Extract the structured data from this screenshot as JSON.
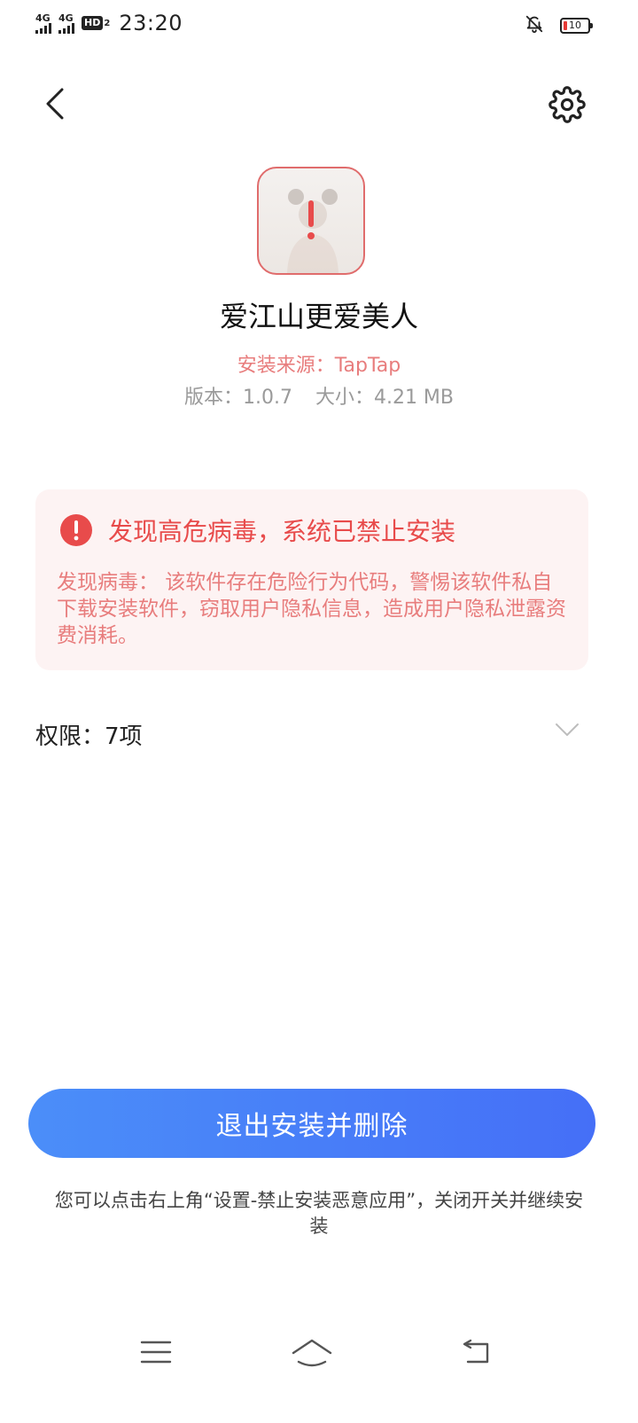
{
  "status_bar": {
    "signal1_label": "4G",
    "signal2_label": "4G",
    "hd_label": "HD",
    "hd_sub": "2",
    "time": "23:20",
    "battery_percent": "10"
  },
  "icons": {
    "back": "back-arrow-icon",
    "settings": "gear-icon",
    "warning": "exclamation-icon",
    "chevron": "chevron-down-icon",
    "nav_menu": "menu-icon",
    "nav_home": "home-icon",
    "nav_back": "return-icon",
    "notifications_off": "bell-off-icon"
  },
  "app": {
    "name": "爱江山更爱美人",
    "source": "安装来源：TapTap",
    "version": "版本：1.0.7",
    "size": "大小：4.21 MB"
  },
  "alert": {
    "title": "发现高危病毒，系统已禁止安装",
    "body": "发现病毒： 该软件存在危险行为代码，警惕该软件私自下载安装软件，窃取用户隐私信息，造成用户隐私泄露资费消耗。"
  },
  "permissions": {
    "label": "权限：7项"
  },
  "actions": {
    "primary": "退出安装并删除",
    "hint": "您可以点击右上角“设置-禁止安装恶意应用”，关闭开关并继续安装"
  },
  "colors": {
    "danger": "#e84b4b",
    "danger_light": "#e87d7d",
    "alert_bg": "#fdf3f3",
    "button_start": "#4b8ef9",
    "button_end": "#456ff7"
  }
}
